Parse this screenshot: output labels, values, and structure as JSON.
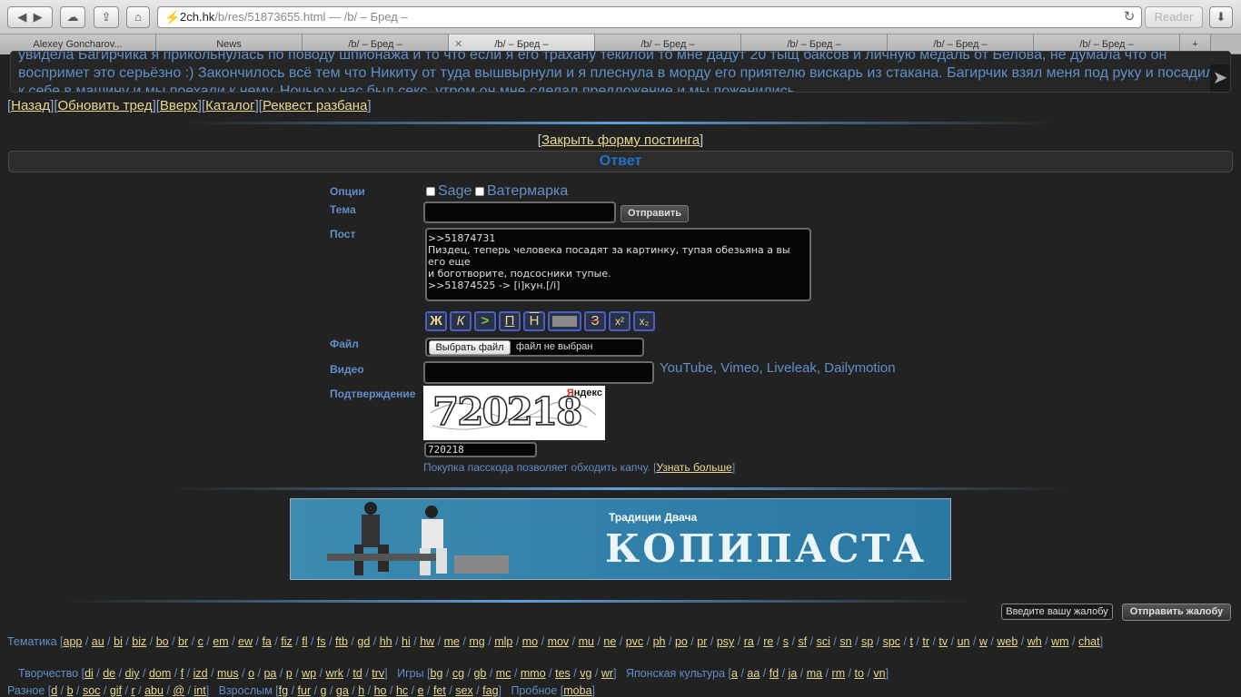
{
  "browser": {
    "url_host": "2ch.hk",
    "url_path": "/b/res/51873655.html",
    "url_suffix": " — /b/ – Бред –",
    "reader_label": "Reader",
    "tabs": [
      {
        "label": "Alexey Goncharov..."
      },
      {
        "label": "News"
      },
      {
        "label": "/b/ – Бред –"
      },
      {
        "label": "/b/ – Бред –"
      },
      {
        "label": "/b/ – Бред –"
      },
      {
        "label": "/b/ – Бред –"
      },
      {
        "label": "/b/ – Бред –"
      },
      {
        "label": "/b/ – Бред –"
      }
    ]
  },
  "post": {
    "line1": "увидела Багирчика я прикольнулась по поводу шпионажа и то что если я его трахану текилой то мне дадут 20 тыщ баксов и личную медаль от Белова, не думала что он",
    "line2": "воспримет это серьёзно :) Закончилось всё тем что Никиту от туда вышвырнули и я плеснула в морду его приятелю вискарь из стакана. Багирчик взял меня под руку и посадил",
    "line3": "к себе в машину и мы поехали к нему. Ночью у нас был секс, утром он мне сделал предложение и мы поженились"
  },
  "nav": {
    "back": "Назад",
    "refresh": "Обновить тред",
    "top": "Вверх",
    "catalog": "Каталог",
    "unban": "Реквест разбана"
  },
  "form": {
    "close_label": "Закрыть форму постинга",
    "reply_title": "Ответ",
    "options_label": "Опции",
    "sage_label": "Sage",
    "watermark_label": "Ватермарка",
    "subject_label": "Тема",
    "subject_value": "",
    "submit_label": "Отправить",
    "post_label": "Пост",
    "post_value": ">>51874731\nПиздец, теперь человека посадят за картинку, тупая обезьяна а вы его еще\nи боготворите, подсосники тупые.\n>>51874525 -> [i]кун.[/i]",
    "markup": {
      "bold": "Ж",
      "italic": "К",
      "quote": ">",
      "underline": "П",
      "overline": "Н",
      "spoiler": "",
      "strike": "З",
      "sup": "x²",
      "sub": "x₂"
    },
    "file_label": "Файл",
    "file_button": "Выбрать файл",
    "file_status": "файл не выбран",
    "video_label": "Видео",
    "video_value": "",
    "video_hosts": "YouTube, Vimeo, Liveleak, Dailymotion",
    "captcha_label": "Подтверждение",
    "captcha_text": "720218",
    "captcha_brand_first": "Я",
    "captcha_brand_rest": "ндекс",
    "captcha_value": "720218",
    "passcode_note": "Покупка пасскода позволяет обходить капчу.",
    "passcode_link": "Узнать больше"
  },
  "banner": {
    "tagline": "Традиции Двача",
    "title": "КОПИПАСТА"
  },
  "report": {
    "input_placeholder": "Введите вашу жалобу",
    "button_label": "Отправить жалобу"
  },
  "boards": {
    "themes_label": "Тематика",
    "themes": [
      "app",
      "au",
      "bi",
      "biz",
      "bo",
      "br",
      "c",
      "em",
      "ew",
      "fa",
      "fiz",
      "fl",
      "fs",
      "ftb",
      "gd",
      "hh",
      "hi",
      "hw",
      "me",
      "mg",
      "mlp",
      "mo",
      "mov",
      "mu",
      "ne",
      "pvc",
      "ph",
      "po",
      "pr",
      "psy",
      "ra",
      "re",
      "s",
      "sf",
      "sci",
      "sn",
      "sp",
      "spc",
      "t",
      "tr",
      "tv",
      "un",
      "w",
      "web",
      "wh",
      "wm",
      "chat"
    ],
    "creative_label": "Творчество",
    "creative": [
      "di",
      "de",
      "diy",
      "dom",
      "f",
      "izd",
      "mus",
      "o",
      "pa",
      "p",
      "wp",
      "wrk",
      "td",
      "trv"
    ],
    "games_label": "Игры",
    "games": [
      "bg",
      "cg",
      "gb",
      "mc",
      "mmo",
      "tes",
      "vg",
      "wr"
    ],
    "japan_label": "Японская культура",
    "japan": [
      "a",
      "aa",
      "fd",
      "ja",
      "ma",
      "rm",
      "to",
      "vn"
    ],
    "misc_label": "Разное",
    "misc": [
      "d",
      "b",
      "soc",
      "gif",
      "r",
      "abu",
      "@",
      "int"
    ],
    "adult_label": "Взрослым",
    "adult": [
      "fg",
      "fur",
      "g",
      "ga",
      "h",
      "ho",
      "hc",
      "e",
      "fet",
      "sex",
      "fag"
    ],
    "trial_label": "Пробное",
    "trial": [
      "moba"
    ]
  }
}
